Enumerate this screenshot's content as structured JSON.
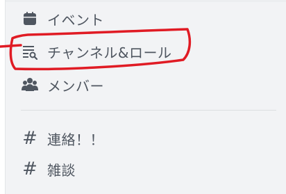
{
  "colors": {
    "sidebar_bg": "#f2f3f5",
    "text_muted": "#4f5660",
    "annotation_red": "#e01b24"
  },
  "menu": {
    "items": [
      {
        "label": "イベント",
        "icon": "calendar-icon"
      },
      {
        "label": "チャンネル&ロール",
        "icon": "channel-browse-icon"
      },
      {
        "label": "メンバー",
        "icon": "members-icon"
      }
    ]
  },
  "channels": [
    {
      "label": "連絡！！",
      "icon": "hash-icon",
      "glyph": "#"
    },
    {
      "label": "雑談",
      "icon": "hash-icon",
      "glyph": "#"
    }
  ]
}
